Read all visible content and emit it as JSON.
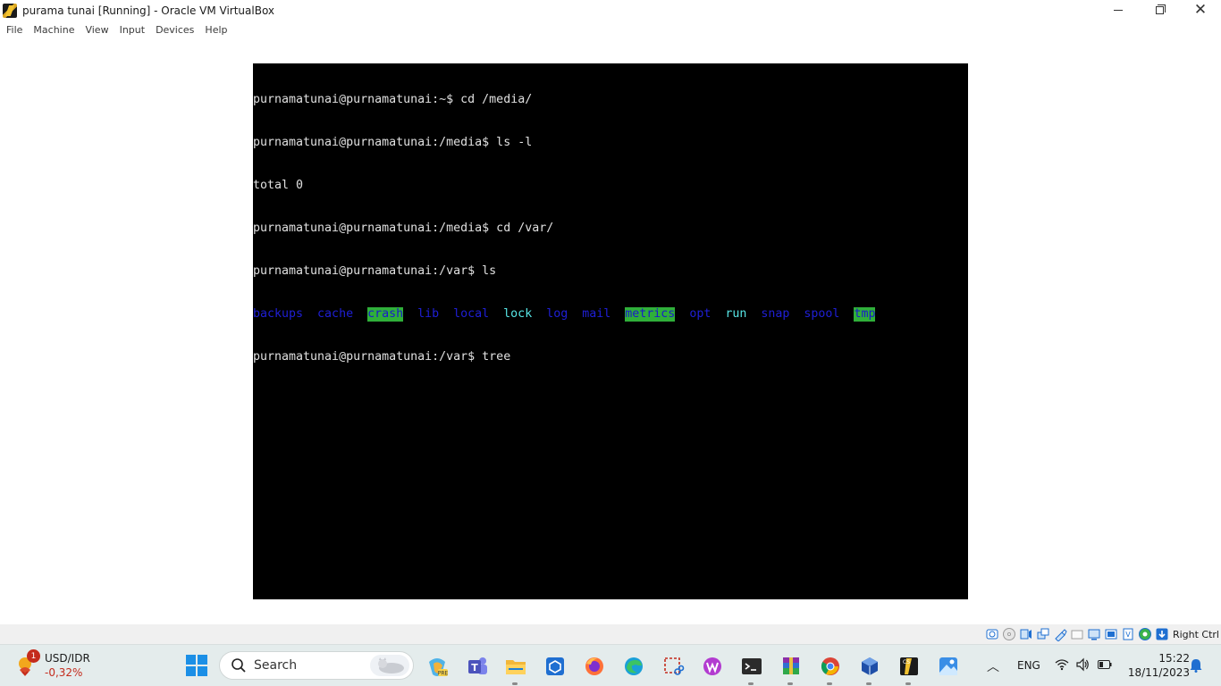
{
  "window": {
    "title": "purama tunai [Running] - Oracle VM VirtualBox",
    "app_icon": "virtualbox-icon"
  },
  "menubar": {
    "items": [
      "File",
      "Machine",
      "View",
      "Input",
      "Devices",
      "Help"
    ]
  },
  "terminal": {
    "lines": [
      "purnamatunai@purnamatunai:~$ cd /media/",
      "purnamatunai@purnamatunai:/media$ ls -l",
      "total 0",
      "purnamatunai@purnamatunai:/media$ cd /var/",
      "purnamatunai@purnamatunai:/var$ ls"
    ],
    "ls_entries": [
      {
        "name": "backups",
        "style": "blue"
      },
      {
        "name": "cache",
        "style": "blue"
      },
      {
        "name": "crash",
        "style": "highlight"
      },
      {
        "name": "lib",
        "style": "blue"
      },
      {
        "name": "local",
        "style": "blue"
      },
      {
        "name": "lock",
        "style": "cyan"
      },
      {
        "name": "log",
        "style": "blue"
      },
      {
        "name": "mail",
        "style": "blue"
      },
      {
        "name": "metrics",
        "style": "highlight"
      },
      {
        "name": "opt",
        "style": "blue"
      },
      {
        "name": "run",
        "style": "cyan"
      },
      {
        "name": "snap",
        "style": "blue"
      },
      {
        "name": "spool",
        "style": "blue"
      },
      {
        "name": "tmp",
        "style": "highlight"
      }
    ],
    "current_line": "purnamatunai@purnamatunai:/var$ tree",
    "colors": {
      "background": "#000000",
      "text": "#e0e0e0",
      "dir": "#1f1fd6",
      "link": "#57e6e6",
      "highlight_bg": "#2faf3a"
    }
  },
  "statusbar": {
    "icons": [
      "hard-disk-icon",
      "optical-drive-icon",
      "audio-icon",
      "network-icon",
      "usb-icon",
      "shared-folder-icon",
      "display-icon",
      "recording-icon",
      "cpu-icon",
      "guest-additions-icon",
      "keyboard-capture-icon"
    ],
    "host_key": "Right Ctrl"
  },
  "taskbar": {
    "widget": {
      "badge": "1",
      "title": "USD/IDR",
      "value": "-0,32%"
    },
    "search_label": "Search",
    "apps": [
      "copilot-icon",
      "teams-icon",
      "file-explorer-icon",
      "store-icon",
      "firefox-icon",
      "edge-icon",
      "snipping-tool-icon",
      "wps-office-icon",
      "terminal-icon",
      "winrar-icon",
      "chrome-icon",
      "virtualbox-icon",
      "virtualbox-vm-icon",
      "photos-icon"
    ],
    "tray": {
      "language": "ENG"
    },
    "clock": {
      "time": "15:22",
      "date": "18/11/2023"
    }
  }
}
